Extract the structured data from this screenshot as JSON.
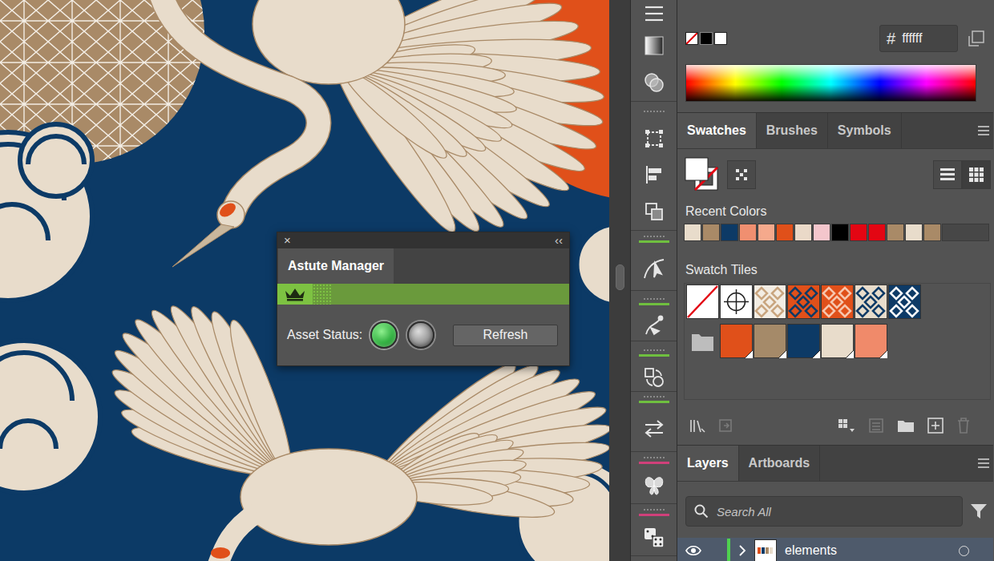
{
  "color_panel": {
    "hash_sign": "#",
    "hex_value": "ffffff"
  },
  "swatches_tabs": [
    {
      "label": "Swatches",
      "selected": true
    },
    {
      "label": "Brushes",
      "selected": false
    },
    {
      "label": "Symbols",
      "selected": false
    }
  ],
  "recent_colors": {
    "label": "Recent Colors",
    "swatches": [
      {
        "color": "#e8dccb"
      },
      {
        "color": "#a98a67"
      },
      {
        "color": "#0d3a66"
      },
      {
        "color": "#f08f70"
      },
      {
        "color": "#f5a98c"
      },
      {
        "color": "#e0501a"
      },
      {
        "color": "#ead9c8"
      },
      {
        "color": "#f4c6cc"
      },
      {
        "color": "#000000"
      },
      {
        "color": "#e30613"
      },
      {
        "color": "#e30613"
      },
      {
        "color": "#a98a67"
      },
      {
        "color": "#e8dccb"
      },
      {
        "color": "#a98a67"
      }
    ]
  },
  "swatch_tiles": {
    "label": "Swatch Tiles",
    "tiles": [
      {
        "kind": "none"
      },
      {
        "kind": "registration"
      },
      {
        "kind": "pattern",
        "color": "#f3ede4",
        "accent": "#c9a57f"
      },
      {
        "kind": "pattern",
        "color": "#e0501a",
        "accent": "#0d3a66"
      },
      {
        "kind": "pattern",
        "color": "#e0501a",
        "accent": "#f6c6ae"
      },
      {
        "kind": "pattern",
        "color": "#e8dccb",
        "accent": "#0d3a66"
      },
      {
        "kind": "pattern",
        "color": "#0d3a66",
        "accent": "#ffffff"
      },
      {
        "kind": "spacer"
      },
      {
        "kind": "folder"
      },
      {
        "kind": "color",
        "color": "#e0501a"
      },
      {
        "kind": "color",
        "color": "#a58a69"
      },
      {
        "kind": "color",
        "color": "#0d3a66"
      },
      {
        "kind": "color",
        "color": "#e8dccb"
      },
      {
        "kind": "color",
        "color": "#f08a6a"
      }
    ]
  },
  "layers_tabs": [
    {
      "label": "Layers",
      "selected": true
    },
    {
      "label": "Artboards",
      "selected": false
    }
  ],
  "layers_search": {
    "placeholder": "Search All"
  },
  "layers": [
    {
      "name": "elements",
      "visible": true,
      "expanded": false,
      "color": "#4fd14f"
    }
  ],
  "astute_manager": {
    "close": "×",
    "collapse": "‹‹",
    "title": "Astute Manager",
    "asset_status_label": "Asset Status:",
    "lights": [
      {
        "on": true,
        "color": "#2fae3f"
      },
      {
        "on": false,
        "color": "#9a9a9a"
      }
    ],
    "refresh": "Refresh"
  }
}
